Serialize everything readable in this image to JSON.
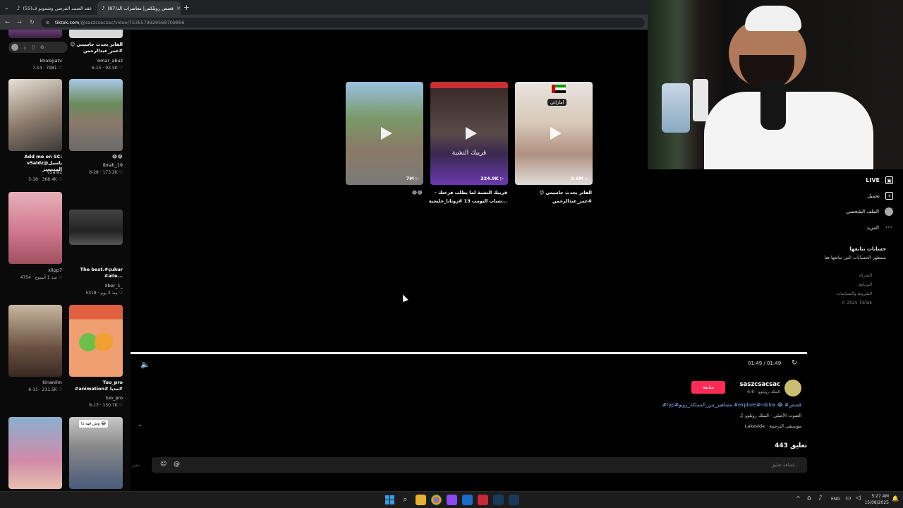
{
  "browser": {
    "tabs": [
      {
        "title": "(55)عقد الصمد الفرضي وشمونو ف"
      },
      {
        "title": "(87)قصص روبلكس| معاصرات الذ"
      }
    ],
    "new_tab": "+",
    "url_prefix": "tiktok.com",
    "url_path": "/@saszcsacsac/video/7535579929568709896"
  },
  "left_grid": {
    "top_row": [
      {
        "caption": "",
        "user": "khalojiatv",
        "date": "7-14",
        "likes": "7981"
      },
      {
        "caption": "الفاتر يحدث جاسيتي 😉 #عمر_عبدالرحمن",
        "user": "omar_abuz",
        "date": "6-15",
        "likes": "92.5K"
      }
    ],
    "rows": [
      [
        {
          "caption": "Add me on SC: v5aldz@ياسبل المتنسير",
          "user": "v5aldz",
          "date": "5-18",
          "likes": "368.4K"
        },
        {
          "caption": "😂😂",
          "user": "ibrah_19",
          "date": "6-28",
          "likes": "173.2K"
        }
      ],
      [
        {
          "caption": "",
          "user": "xlipp7",
          "date": "منذ 1 أسبوع",
          "likes": "4754"
        },
        {
          "caption": "The best.#çukur #aile...",
          "user": "liber_1_",
          "date": "منذ 3 يوم",
          "likes": "5318"
        }
      ],
      [
        {
          "caption": "",
          "user": "kinanilm",
          "date": "6-11",
          "likes": "211.5K"
        },
        {
          "caption": "Tuo_pro #animation# مديا#",
          "user": "tuo_pro",
          "date": "6-13",
          "likes": "150.7K"
        }
      ],
      [
        {
          "caption": "",
          "user": "",
          "date": "",
          "likes": ""
        },
        {
          "caption": "وش فيه ذا 😂",
          "user": "",
          "date": "",
          "likes": ""
        }
      ]
    ]
  },
  "related": [
    {
      "count": "7M",
      "caption": "😂😂"
    },
    {
      "count": "324.9K",
      "caption": "قريبك النشبة لما يطلب فزعتك – شباب البومب 13 #روتانا_خليجية..."
    },
    {
      "count": "3.6M",
      "caption": "الفاتر يحدث جاسيتي 😉 #عمر_عبدالرحمن"
    }
  ],
  "related_overlay": {
    "shop_sign": "قريبك النشبة",
    "caption_tag": "اماراتي"
  },
  "player": {
    "time": "01:49 / 01:49",
    "progress": 1.0
  },
  "post": {
    "username": "saszcsacsac",
    "subtitle": "الملك روبلوو · 8-6",
    "follow": "متابعة",
    "hashtags": "#typ#مشاهير_من_المملكة_روبو #explore#roblox 😂 #قصص",
    "sound": "♫ الصوت الأصلي - الملك روبلوو",
    "music": "Lakeside · موسيقى الترجمة",
    "comments_count": "443 تعليق",
    "comment_placeholder": "إضافة تعليق...",
    "post_btn": "نشر"
  },
  "sidebar": {
    "items": [
      {
        "label": "LIVE"
      },
      {
        "label": "تحميل"
      },
      {
        "label": "الملف الشخصي"
      },
      {
        "label": "المزيد"
      }
    ],
    "following_title": "حسابات تتابعها",
    "following_sub": "ستظهر الحسابات التي تتابعها هنا",
    "links": [
      "الشركة",
      "البرنامج",
      "الشروط والسياسات",
      "© 2025 TikTok"
    ]
  },
  "taskbar": {
    "lang": "ENG",
    "time": "5:27 AM",
    "date": "15/08/2025"
  },
  "colors": {
    "accent": "#fe2c55",
    "bg": "#000000",
    "tab_active": "#35363a"
  }
}
